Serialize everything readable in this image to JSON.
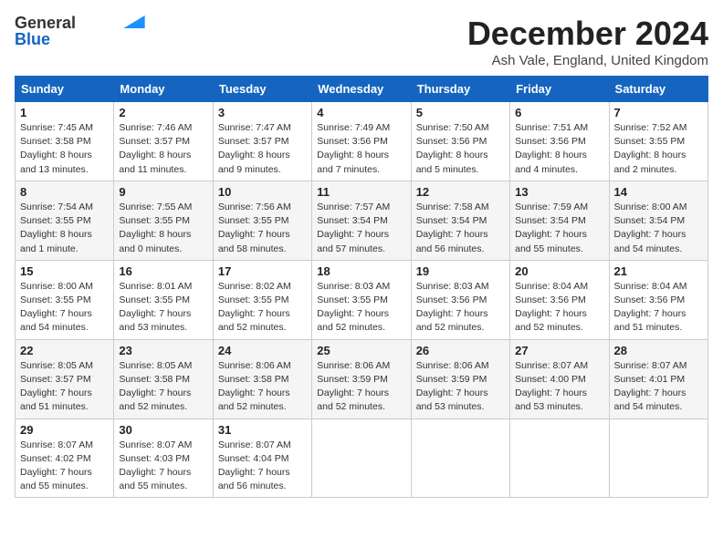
{
  "logo": {
    "general": "General",
    "blue": "Blue",
    "arrow_color": "#1e90ff"
  },
  "title": "December 2024",
  "subtitle": "Ash Vale, England, United Kingdom",
  "days_of_week": [
    "Sunday",
    "Monday",
    "Tuesday",
    "Wednesday",
    "Thursday",
    "Friday",
    "Saturday"
  ],
  "weeks": [
    [
      {
        "day": "1",
        "sunrise": "7:45 AM",
        "sunset": "3:58 PM",
        "daylight": "8 hours and 13 minutes."
      },
      {
        "day": "2",
        "sunrise": "7:46 AM",
        "sunset": "3:57 PM",
        "daylight": "8 hours and 11 minutes."
      },
      {
        "day": "3",
        "sunrise": "7:47 AM",
        "sunset": "3:57 PM",
        "daylight": "8 hours and 9 minutes."
      },
      {
        "day": "4",
        "sunrise": "7:49 AM",
        "sunset": "3:56 PM",
        "daylight": "8 hours and 7 minutes."
      },
      {
        "day": "5",
        "sunrise": "7:50 AM",
        "sunset": "3:56 PM",
        "daylight": "8 hours and 5 minutes."
      },
      {
        "day": "6",
        "sunrise": "7:51 AM",
        "sunset": "3:56 PM",
        "daylight": "8 hours and 4 minutes."
      },
      {
        "day": "7",
        "sunrise": "7:52 AM",
        "sunset": "3:55 PM",
        "daylight": "8 hours and 2 minutes."
      }
    ],
    [
      {
        "day": "8",
        "sunrise": "7:54 AM",
        "sunset": "3:55 PM",
        "daylight": "8 hours and 1 minute."
      },
      {
        "day": "9",
        "sunrise": "7:55 AM",
        "sunset": "3:55 PM",
        "daylight": "8 hours and 0 minutes."
      },
      {
        "day": "10",
        "sunrise": "7:56 AM",
        "sunset": "3:55 PM",
        "daylight": "7 hours and 58 minutes."
      },
      {
        "day": "11",
        "sunrise": "7:57 AM",
        "sunset": "3:54 PM",
        "daylight": "7 hours and 57 minutes."
      },
      {
        "day": "12",
        "sunrise": "7:58 AM",
        "sunset": "3:54 PM",
        "daylight": "7 hours and 56 minutes."
      },
      {
        "day": "13",
        "sunrise": "7:59 AM",
        "sunset": "3:54 PM",
        "daylight": "7 hours and 55 minutes."
      },
      {
        "day": "14",
        "sunrise": "8:00 AM",
        "sunset": "3:54 PM",
        "daylight": "7 hours and 54 minutes."
      }
    ],
    [
      {
        "day": "15",
        "sunrise": "8:00 AM",
        "sunset": "3:55 PM",
        "daylight": "7 hours and 54 minutes."
      },
      {
        "day": "16",
        "sunrise": "8:01 AM",
        "sunset": "3:55 PM",
        "daylight": "7 hours and 53 minutes."
      },
      {
        "day": "17",
        "sunrise": "8:02 AM",
        "sunset": "3:55 PM",
        "daylight": "7 hours and 52 minutes."
      },
      {
        "day": "18",
        "sunrise": "8:03 AM",
        "sunset": "3:55 PM",
        "daylight": "7 hours and 52 minutes."
      },
      {
        "day": "19",
        "sunrise": "8:03 AM",
        "sunset": "3:56 PM",
        "daylight": "7 hours and 52 minutes."
      },
      {
        "day": "20",
        "sunrise": "8:04 AM",
        "sunset": "3:56 PM",
        "daylight": "7 hours and 52 minutes."
      },
      {
        "day": "21",
        "sunrise": "8:04 AM",
        "sunset": "3:56 PM",
        "daylight": "7 hours and 51 minutes."
      }
    ],
    [
      {
        "day": "22",
        "sunrise": "8:05 AM",
        "sunset": "3:57 PM",
        "daylight": "7 hours and 51 minutes."
      },
      {
        "day": "23",
        "sunrise": "8:05 AM",
        "sunset": "3:58 PM",
        "daylight": "7 hours and 52 minutes."
      },
      {
        "day": "24",
        "sunrise": "8:06 AM",
        "sunset": "3:58 PM",
        "daylight": "7 hours and 52 minutes."
      },
      {
        "day": "25",
        "sunrise": "8:06 AM",
        "sunset": "3:59 PM",
        "daylight": "7 hours and 52 minutes."
      },
      {
        "day": "26",
        "sunrise": "8:06 AM",
        "sunset": "3:59 PM",
        "daylight": "7 hours and 53 minutes."
      },
      {
        "day": "27",
        "sunrise": "8:07 AM",
        "sunset": "4:00 PM",
        "daylight": "7 hours and 53 minutes."
      },
      {
        "day": "28",
        "sunrise": "8:07 AM",
        "sunset": "4:01 PM",
        "daylight": "7 hours and 54 minutes."
      }
    ],
    [
      {
        "day": "29",
        "sunrise": "8:07 AM",
        "sunset": "4:02 PM",
        "daylight": "7 hours and 55 minutes."
      },
      {
        "day": "30",
        "sunrise": "8:07 AM",
        "sunset": "4:03 PM",
        "daylight": "7 hours and 55 minutes."
      },
      {
        "day": "31",
        "sunrise": "8:07 AM",
        "sunset": "4:04 PM",
        "daylight": "7 hours and 56 minutes."
      },
      null,
      null,
      null,
      null
    ]
  ]
}
